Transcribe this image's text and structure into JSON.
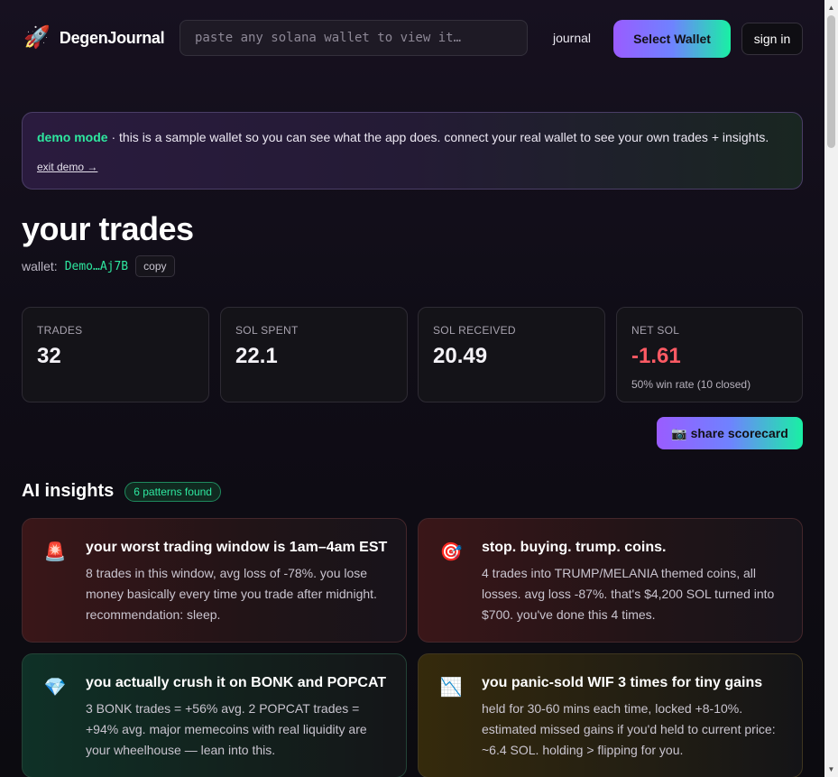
{
  "header": {
    "logo_icon": "🚀",
    "logo_text": "DegenJournal",
    "search_placeholder": "paste any solana wallet to view it…",
    "nav_journal": "journal",
    "select_wallet": "Select Wallet",
    "sign_in": "sign in"
  },
  "demo": {
    "strong": "demo mode",
    "text": " · this is a sample wallet so you can see what the app does. connect your real wallet to see your own trades + insights.",
    "exit": "exit demo →"
  },
  "page": {
    "title": "your trades",
    "wallet_label": "wallet:",
    "wallet_address": "Demo…Aj7B",
    "copy": "copy"
  },
  "stats": [
    {
      "label": "TRADES",
      "value": "32",
      "sub": ""
    },
    {
      "label": "SOL SPENT",
      "value": "22.1",
      "sub": ""
    },
    {
      "label": "SOL RECEIVED",
      "value": "20.49",
      "sub": ""
    },
    {
      "label": "NET SOL",
      "value": "-1.61",
      "sub": "50% win rate (10 closed)"
    }
  ],
  "share_button": "📷 share scorecard",
  "insights": {
    "title": "AI insights",
    "badge": "6 patterns found",
    "cards": [
      {
        "icon": "🚨",
        "icon_name": "siren-icon",
        "tone": "red",
        "title": "your worst trading window is 1am–4am EST",
        "body": "8 trades in this window, avg loss of -78%. you lose money basically every time you trade after midnight. recommendation: sleep."
      },
      {
        "icon": "🎯",
        "icon_name": "target-icon",
        "tone": "red",
        "title": "stop. buying. trump. coins.",
        "body": "4 trades into TRUMP/MELANIA themed coins, all losses. avg loss -87%. that's $4,200 SOL turned into $700. you've done this 4 times."
      },
      {
        "icon": "💎",
        "icon_name": "diamond-icon",
        "tone": "green",
        "title": "you actually crush it on BONK and POPCAT",
        "body": "3 BONK trades = +56% avg. 2 POPCAT trades = +94% avg. major memecoins with real liquidity are your wheelhouse — lean into this."
      },
      {
        "icon": "📉",
        "icon_name": "chart-down-icon",
        "tone": "yellow",
        "title": "you panic-sold WIF 3 times for tiny gains",
        "body": "held for 30-60 mins each time, locked +8-10%. estimated missed gains if you'd held to current price: ~6.4 SOL. holding > flipping for you."
      }
    ]
  },
  "colors": {
    "accent_green": "#2ee79f",
    "accent_purple": "#9a5cff",
    "negative": "#ff5a64"
  }
}
